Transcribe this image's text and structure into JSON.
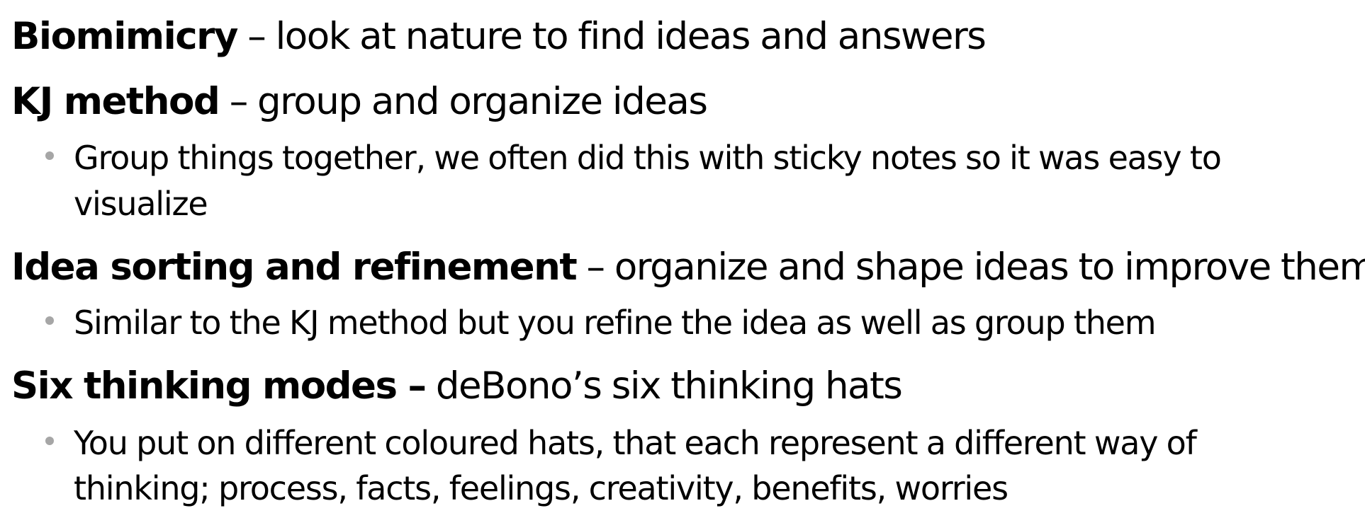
{
  "items": [
    {
      "term": "Biomimicry",
      "definition": " – look at nature to find ideas and answers",
      "sub": []
    },
    {
      "term": "KJ method",
      "definition": " – group and organize ideas",
      "sub": [
        [
          "Group things together, we often did this with sticky notes so it was easy to",
          "visualize"
        ]
      ]
    },
    {
      "term": "Idea sorting and refinement",
      "definition": " – organize and shape ideas to improve them",
      "sub": [
        [
          "Similar to the KJ method but you refine the idea as well as group them"
        ]
      ]
    },
    {
      "term": "Six thinking modes –",
      "definition": " deBono’s six thinking hats",
      "sub": [
        [
          "You put on different coloured hats, that each represent a different way of",
          "thinking; process, facts, feelings, creativity, benefits, worries"
        ]
      ]
    }
  ],
  "colors": {
    "text": "#000000",
    "bullet": "#a6a6a6"
  }
}
